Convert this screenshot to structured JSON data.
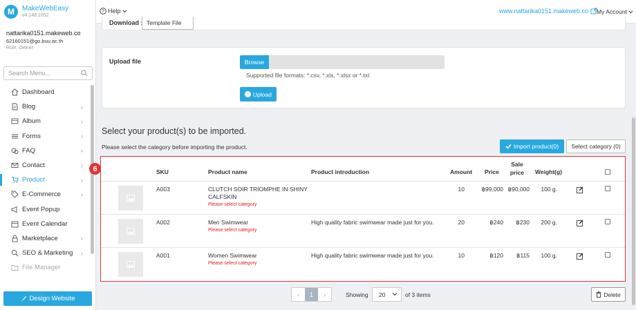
{
  "brand": {
    "name": "MakeWebEasy",
    "version": "v4.148.1652",
    "logo_letter": "M"
  },
  "account": {
    "site": "nattarika0151.makeweb.co",
    "email": "62160151@go.buu.ac.th",
    "role": "Role: Owner"
  },
  "search": {
    "placeholder": "Search Menu..."
  },
  "menu": [
    {
      "label": "Dashboard",
      "icon": "home-icon",
      "chevron": false,
      "state": "normal"
    },
    {
      "label": "Blog",
      "icon": "document-icon",
      "chevron": true,
      "state": "normal"
    },
    {
      "label": "Album",
      "icon": "album-icon",
      "chevron": true,
      "state": "normal"
    },
    {
      "label": "Forms",
      "icon": "list-icon",
      "chevron": true,
      "state": "normal"
    },
    {
      "label": "FAQ",
      "icon": "faq-icon",
      "chevron": true,
      "state": "normal"
    },
    {
      "label": "Contact",
      "icon": "envelope-icon",
      "chevron": true,
      "state": "normal"
    },
    {
      "label": "Product",
      "icon": "cart-icon",
      "chevron": true,
      "state": "active"
    },
    {
      "label": "E-Commerce",
      "icon": "tag-icon",
      "chevron": true,
      "state": "normal"
    },
    {
      "label": "Event Popup",
      "icon": "megaphone-icon",
      "chevron": false,
      "state": "normal"
    },
    {
      "label": "Event Calendar",
      "icon": "calendar-icon",
      "chevron": false,
      "state": "normal"
    },
    {
      "label": "Marketplace",
      "icon": "lock-icon",
      "chevron": true,
      "state": "normal"
    },
    {
      "label": "SEO & Marketing",
      "icon": "seo-icon",
      "chevron": true,
      "state": "normal"
    },
    {
      "label": "File Manager",
      "icon": "folder-icon",
      "chevron": false,
      "state": "disabled"
    }
  ],
  "design_button": "Design Website",
  "topbar": {
    "help": "Help",
    "site_link": "www.nattarika0151.makeweb.co",
    "my_account": "My Account"
  },
  "download": {
    "label": "Download :",
    "template_button": "Template File"
  },
  "upload": {
    "label": "Upload file",
    "browse": "Browse",
    "formats": "Supported file formats: *.csv, *.xls, *.xlsx or *.txt",
    "upload_button": "Upload"
  },
  "select": {
    "title": "Select your product(s) to be imported.",
    "note": "Please select the category before importing the product.",
    "import_button": "Import product(0)",
    "select_category_button": "Select category (0)"
  },
  "badge": "6",
  "table": {
    "headers": {
      "sku": "SKU",
      "name": "Product name",
      "intro": "Product introduction",
      "amount": "Amount",
      "price": "Price",
      "sale": "Sale price",
      "weight": "Weight(g)"
    },
    "rows": [
      {
        "sku": "A003",
        "name": "CLUTCH SOIR TRIOMPHE IN SHINY CALFSKIN",
        "error": "Please select category",
        "intro": "",
        "amount": "10",
        "price": "฿99,000",
        "sale": "฿90,000",
        "weight": "100 g."
      },
      {
        "sku": "A002",
        "name": "Men Swimwear",
        "error": "Please select category",
        "intro": "High quality fabric swimwear made just for you.",
        "amount": "20",
        "price": "฿240",
        "sale": "฿230",
        "weight": "200 g."
      },
      {
        "sku": "A001",
        "name": "Women Swimwear",
        "error": "Please select category",
        "intro": "High quality fabric swimwear made just for you.",
        "amount": "10",
        "price": "฿120",
        "sale": "฿115",
        "weight": "100 g."
      }
    ]
  },
  "footer": {
    "prev": "‹",
    "page": "1",
    "next": "›",
    "showing": "Showing",
    "per_page": "20",
    "of_items": "of 3 items",
    "delete": "Delete"
  }
}
